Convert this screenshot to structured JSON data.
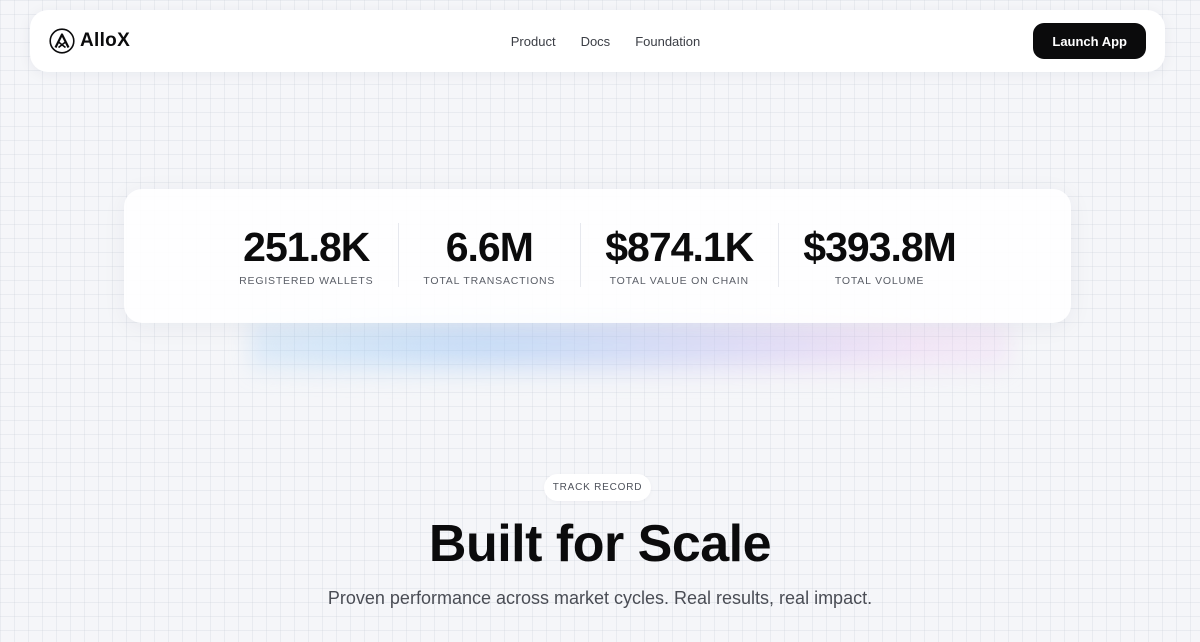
{
  "nav": {
    "logo_text": "AlloX",
    "links": [
      "Product",
      "Docs",
      "Foundation"
    ],
    "cta_label": "Launch App"
  },
  "stats": [
    {
      "value": "251.8K",
      "label": "REGISTERED WALLETS"
    },
    {
      "value": "6.6M",
      "label": "TOTAL TRANSACTIONS"
    },
    {
      "value": "$874.1K",
      "label": "TOTAL VALUE ON CHAIN"
    },
    {
      "value": "$393.8M",
      "label": "TOTAL VOLUME"
    }
  ],
  "section": {
    "badge": "TRACK RECORD",
    "title": "Built for Scale",
    "subtitle": "Proven performance across market cycles. Real results, real impact."
  }
}
